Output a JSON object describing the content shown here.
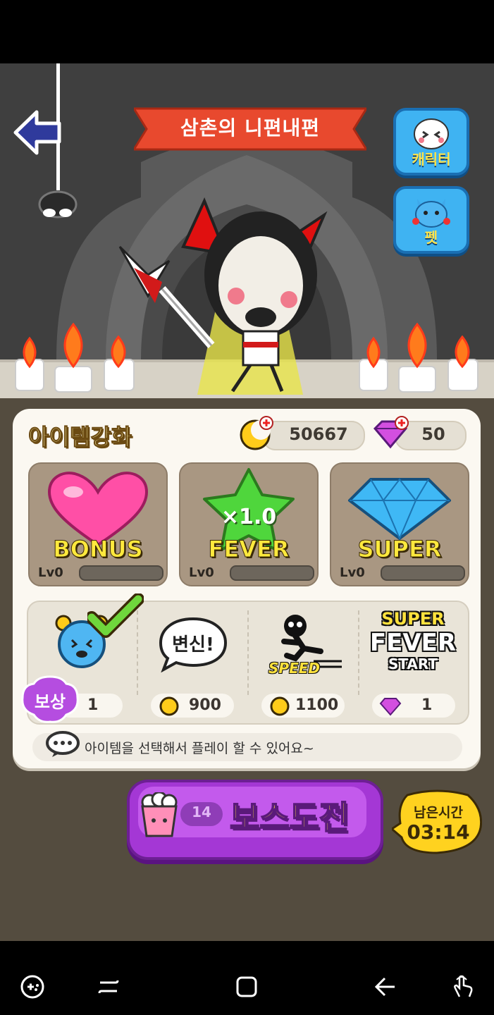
{
  "title": "삼촌의 니편내편",
  "side_buttons": {
    "character": "캐릭터",
    "pet": "펫"
  },
  "panel": {
    "title": "아이템강화",
    "gold": "50667",
    "gems": "50"
  },
  "upgrades": [
    {
      "label": "BONUS",
      "level": "Lv0"
    },
    {
      "label": "FEVER",
      "multiplier": "×1.0",
      "level": "Lv0"
    },
    {
      "label": "SUPER",
      "level": "Lv0"
    }
  ],
  "items": [
    {
      "name": "alarm-clock",
      "badge": "보상",
      "count": "1"
    },
    {
      "name": "transform",
      "bubble": "변신!",
      "cost": "900"
    },
    {
      "name": "speed",
      "label": "SPEED",
      "cost": "1100"
    },
    {
      "name": "super-fever-start",
      "label_top": "SUPER",
      "label_mid": "FEVER",
      "label_bot": "START",
      "cost": "1"
    }
  ],
  "hint": "아이템을 선택해서 플레이 할 수 있어요~",
  "boss": {
    "label": "보스도전",
    "tickets": "14"
  },
  "timer": {
    "label": "남은시간",
    "value": "03:14"
  },
  "colors": {
    "accent": "#a437d5",
    "gold": "#ffe93d",
    "sky": "#3fb3f2"
  }
}
